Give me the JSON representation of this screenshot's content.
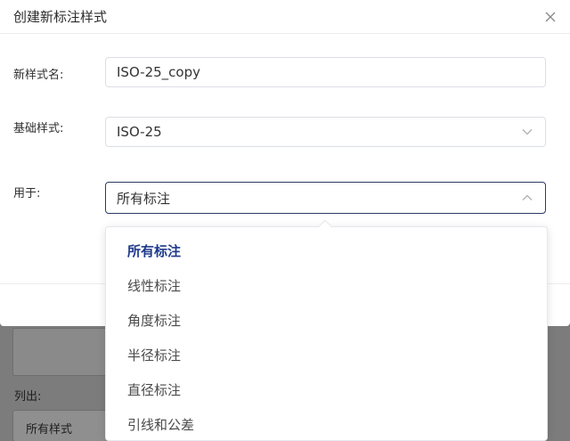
{
  "background": {
    "list_label": "列出:",
    "list_select_value": "所有样式"
  },
  "modal": {
    "title": "创建新标注样式",
    "close_icon": "close-icon",
    "fields": {
      "new_style_name": {
        "label": "新样式名:",
        "value": "ISO-25_copy"
      },
      "base_style": {
        "label": "基础样式:",
        "value": "ISO-25"
      },
      "use_for": {
        "label": "用于:",
        "value": "所有标注"
      }
    }
  },
  "dropdown": {
    "selected_index": 0,
    "options": [
      "所有标注",
      "线性标注",
      "角度标注",
      "半径标注",
      "直径标注",
      "引线和公差"
    ]
  },
  "colors": {
    "selected_option": "#1e3a8a",
    "primary_button": "#1a56c9",
    "active_border": "#2b3a66"
  }
}
